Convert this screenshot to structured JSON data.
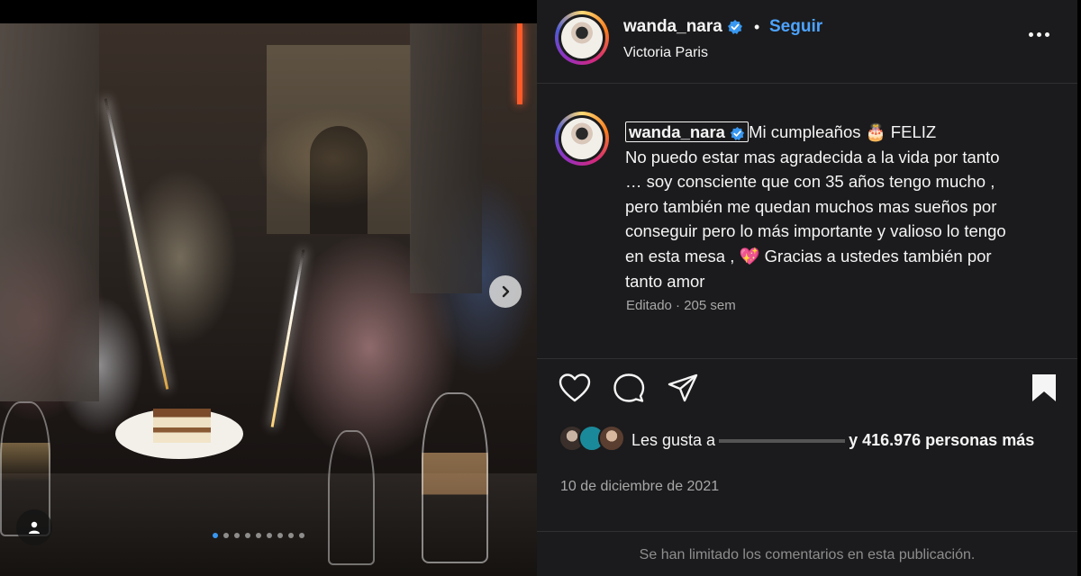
{
  "post": {
    "username": "wanda_nara",
    "follow_label": "Seguir",
    "follow_separator": "•",
    "location": "Victoria Paris",
    "caption_lines": [
      "Mi cumpleaños 🎂 FELIZ",
      "No puedo estar mas agradecida a la vida por tanto",
      "… soy consciente que con 35 años tengo mucho ,",
      "pero también me quedan muchos mas sueños por",
      "conseguir pero lo más importante y valioso lo tengo",
      "en esta mesa , 💖 Gracias a ustedes también por",
      "tanto amor"
    ],
    "edited_label": "Editado · 205 sem",
    "likes_prefix": "Les gusta a",
    "likes_suffix": "y 416.976 personas más",
    "date": "10 de diciembre de 2021",
    "comments_limited": "Se han limitado los comentarios en esta publicación."
  },
  "carousel": {
    "dot_count": 9,
    "active_index": 0
  },
  "colors": {
    "accent": "#4da3ff",
    "verified": "#3897f0",
    "panel_bg": "#1b1b1d",
    "muted": "#a8a8a8"
  },
  "icons": {
    "next": "chevron-right-icon",
    "user_tag": "user-icon",
    "like": "heart-icon",
    "comment": "comment-icon",
    "share": "paper-plane-icon",
    "save": "bookmark-filled-icon",
    "more": "more-horizontal-icon",
    "verified": "verified-badge-icon"
  }
}
